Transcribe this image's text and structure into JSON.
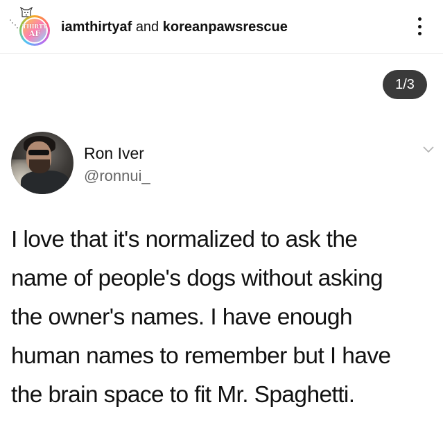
{
  "header": {
    "account": "iamthirtyaf",
    "conjunction": "and",
    "collaborator": "koreanpawsrescue",
    "avatar_badge_line1": "THIRTY",
    "avatar_badge_line2": "AF"
  },
  "carousel": {
    "page_indicator": "1/3"
  },
  "tweet": {
    "display_name": "Ron Iver",
    "handle": "@ronnui_",
    "text_lines": [
      "I love that it's normalized to ask the",
      "name of people's dogs without asking",
      "the owner's names. I have enough",
      "human names to remember but I have",
      "the brain space to fit Mr. Spaghetti."
    ]
  },
  "icons": {
    "more": "more-options-icon",
    "chevron": "chevron-down-icon",
    "dog": "dog-icon"
  }
}
